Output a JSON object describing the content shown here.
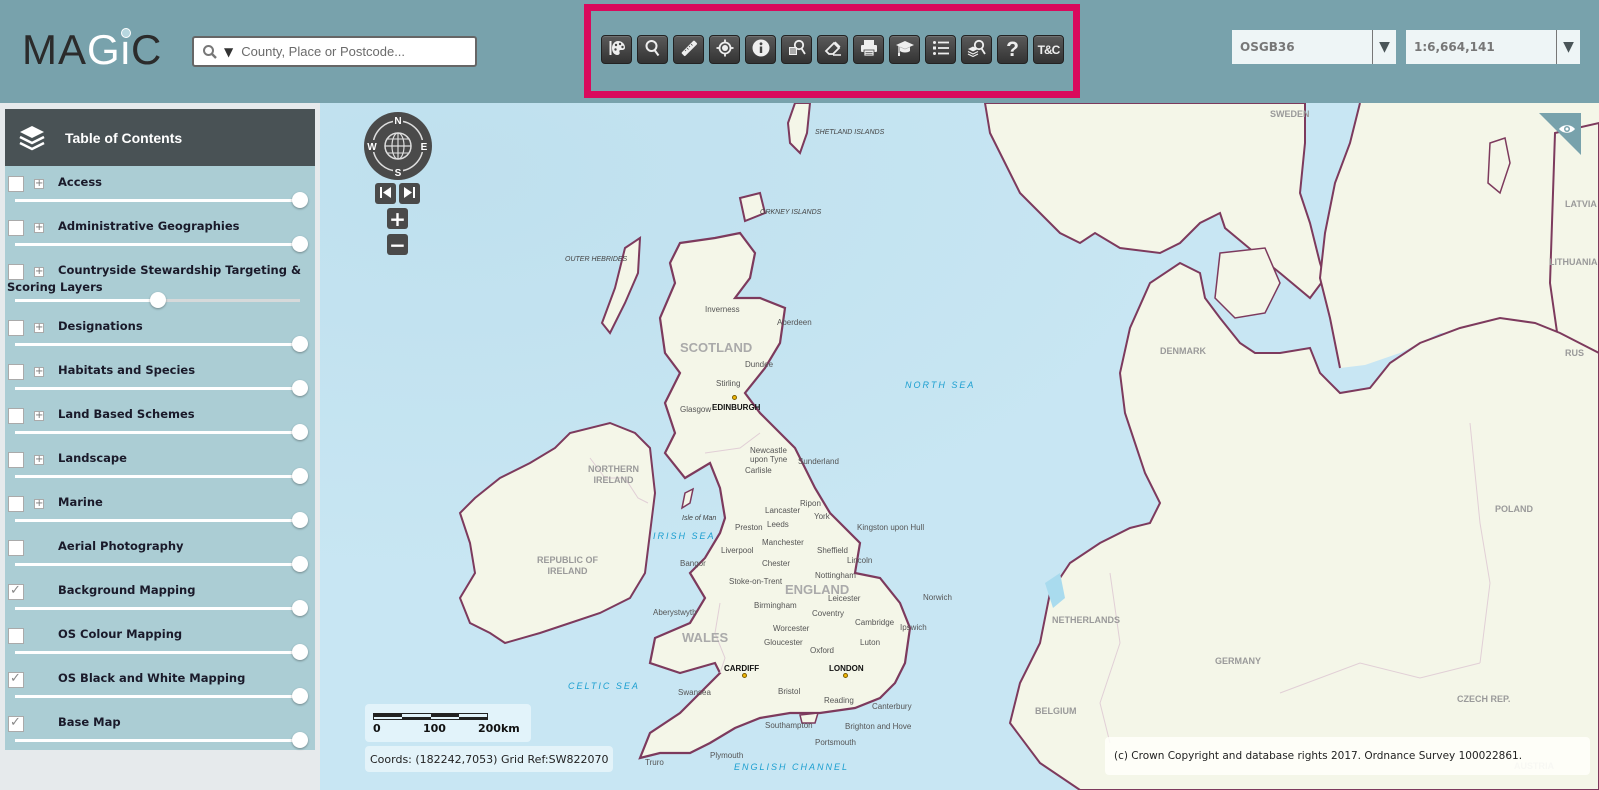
{
  "app": {
    "logo": {
      "m": "MA",
      "g": "G",
      "i": "i",
      "c": "C"
    }
  },
  "search": {
    "placeholder": "County, Place or Postcode...",
    "value": "",
    "icon": "search-icon",
    "dropdown_icon": "caret-down-icon"
  },
  "toolbar": {
    "highlight_color": "#d9095c",
    "tools": [
      {
        "name": "style-tool",
        "icon": "palette-icon",
        "label": ""
      },
      {
        "name": "search-tool",
        "icon": "magnifier-icon",
        "label": ""
      },
      {
        "name": "measure-tool",
        "icon": "ruler-icon",
        "label": ""
      },
      {
        "name": "locate-tool",
        "icon": "crosshair-icon",
        "label": ""
      },
      {
        "name": "identify-tool",
        "icon": "info-icon",
        "label": ""
      },
      {
        "name": "query-tool",
        "icon": "document-search-icon",
        "label": ""
      },
      {
        "name": "clear-tool",
        "icon": "eraser-icon",
        "label": ""
      },
      {
        "name": "print-tool",
        "icon": "printer-icon",
        "label": ""
      },
      {
        "name": "help-guide-tool",
        "icon": "mortarboard-icon",
        "label": ""
      },
      {
        "name": "legend-tool",
        "icon": "list-icon",
        "label": ""
      },
      {
        "name": "layer-search-tool",
        "icon": "layers-search-icon",
        "label": ""
      },
      {
        "name": "help-tool",
        "icon": "question-icon",
        "label": "?"
      },
      {
        "name": "terms-tool",
        "icon": "terms-icon",
        "label": "T&C"
      }
    ]
  },
  "projection": {
    "value": "OSGB36",
    "arrow": "▼"
  },
  "scale": {
    "value": "1:6,664,141",
    "arrow": "▼"
  },
  "toc": {
    "title": "Table of Contents",
    "items": [
      {
        "label": "Access",
        "checked": false,
        "expandable": true,
        "opacity": 1.0
      },
      {
        "label": "Administrative Geographies",
        "checked": false,
        "expandable": true,
        "opacity": 1.0
      },
      {
        "label": "Countryside Stewardship Targeting & Scoring Layers",
        "checked": false,
        "expandable": true,
        "opacity": 0.5
      },
      {
        "label": "Designations",
        "checked": false,
        "expandable": true,
        "opacity": 1.0
      },
      {
        "label": "Habitats and Species",
        "checked": false,
        "expandable": true,
        "opacity": 1.0
      },
      {
        "label": "Land Based Schemes",
        "checked": false,
        "expandable": true,
        "opacity": 1.0
      },
      {
        "label": "Landscape",
        "checked": false,
        "expandable": true,
        "opacity": 1.0
      },
      {
        "label": "Marine",
        "checked": false,
        "expandable": true,
        "opacity": 1.0
      },
      {
        "label": "Aerial Photography",
        "checked": false,
        "expandable": false,
        "opacity": 1.0
      },
      {
        "label": "Background Mapping",
        "checked": true,
        "expandable": false,
        "opacity": 1.0
      },
      {
        "label": "OS Colour Mapping",
        "checked": false,
        "expandable": false,
        "opacity": 1.0
      },
      {
        "label": "OS Black and White Mapping",
        "checked": true,
        "expandable": false,
        "opacity": 1.0
      },
      {
        "label": "Base Map",
        "checked": true,
        "expandable": false,
        "opacity": 1.0
      }
    ]
  },
  "map": {
    "compass": {
      "n": "N",
      "s": "S",
      "e": "E",
      "w": "W"
    },
    "zoom_in": "+",
    "zoom_out": "−",
    "scalebar": {
      "labels": [
        "0",
        "100",
        "200km"
      ]
    },
    "coords_text": "Coords: (182242,7053) Grid Ref:SW822070",
    "attribution": "(c) Crown Copyright and database rights 2017. Ordnance Survey 100022861.",
    "labels": {
      "countries": {
        "scotland": "SCOTLAND",
        "england": "ENGLAND",
        "wales": "WALES",
        "northern_ireland": "NORTHERN\nIRELAND",
        "republic_of_ireland": "REPUBLIC OF\nIRELAND",
        "denmark": "DENMARK",
        "sweden": "SWEDEN",
        "netherlands": "NETHERLANDS",
        "germany": "GERMANY",
        "belgium": "BELGIUM",
        "poland": "POLAND",
        "czech": "CZECH REP.",
        "latvia": "LATVIA",
        "lithuania": "LITHUANIA",
        "russia": "RUS",
        "austria": "AUSTRIA"
      },
      "seas": {
        "north_sea": "NORTH SEA",
        "irish_sea": "IRISH SEA",
        "celtic_sea": "CELTIC SEA",
        "english_channel": "ENGLISH CHANNEL"
      },
      "islands": {
        "shetland": "SHETLAND\nISLANDS",
        "orkney": "ORKNEY\nISLANDS",
        "outer_hebrides": "OUTER\nHEBRIDES",
        "isle_of_man": "Isle of Man"
      },
      "capitals": {
        "edinburgh": "EDINBURGH",
        "cardiff": "CARDIFF",
        "london": "LONDON"
      },
      "cities": {
        "inverness": "Inverness",
        "aberdeen": "Aberdeen",
        "dundee": "Dundee",
        "stirling": "Stirling",
        "glasgow": "Glasgow",
        "newcastle": "Newcastle\nupon Tyne",
        "sunderland": "Sunderland",
        "carlisle": "Carlisle",
        "ripon": "Ripon",
        "lancaster": "Lancaster",
        "york": "York",
        "leeds": "Leeds",
        "preston": "Preston",
        "hull": "Kingston upon Hull",
        "manchester": "Manchester",
        "liverpool": "Liverpool",
        "sheffield": "Sheffield",
        "bangor": "Bangor",
        "chester": "Chester",
        "lincoln": "Lincoln",
        "stoke": "Stoke-on-Trent",
        "nottingham": "Nottingham",
        "leicester": "Leicester",
        "norwich": "Norwich",
        "birmingham": "Birmingham",
        "aberystwyth": "Aberystwyth",
        "coventry": "Coventry",
        "cambridge": "Cambridge",
        "worcester": "Worcester",
        "ipswich": "Ipswich",
        "gloucester": "Gloucester",
        "luton": "Luton",
        "oxford": "Oxford",
        "swansea": "Swansea",
        "bristol": "Bristol",
        "reading": "Reading",
        "canterbury": "Canterbury",
        "southampton": "Southampton",
        "brighton": "Brighton and Hove",
        "portsmouth": "Portsmouth",
        "plymouth": "Plymouth",
        "truro": "Truro"
      }
    },
    "colors": {
      "sea": "#c8e6f3",
      "land": "#f4f6e8",
      "coastline": "#7d3a5d"
    }
  }
}
